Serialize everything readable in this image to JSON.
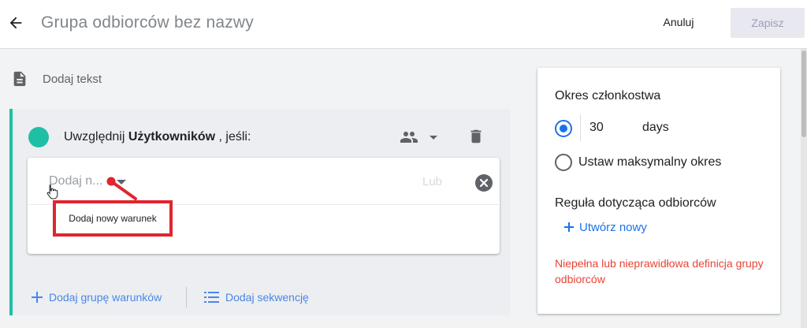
{
  "header": {
    "title": "Grupa odbiorców bez nazwy",
    "cancel_label": "Anuluj",
    "save_label": "Zapisz"
  },
  "add_text": {
    "label": "Dodaj tekst"
  },
  "condition_group": {
    "include_prefix": "Uwzględnij",
    "include_entity": "Użytkowników",
    "include_suffix": ", jeśli:",
    "condition": {
      "select_placeholder": "Dodaj n...",
      "or_label": "Lub",
      "tooltip": "Dodaj nowy warunek"
    },
    "add_group_label": "Dodaj grupę warunków",
    "add_sequence_label": "Dodaj sekwencję"
  },
  "side_panel": {
    "membership_heading": "Okres członkostwa",
    "days_value": "30",
    "days_unit": "days",
    "max_period_label": "Ustaw maksymalny okres",
    "selected_option": "days",
    "rule_heading": "Reguła dotycząca odbiorców",
    "create_label": "Utwórz nowy",
    "error_message": "Niepełna lub nieprawidłowa definicja grupy odbiorców"
  },
  "colors": {
    "accent_teal": "#1fbfa5",
    "link_blue": "#4a86e8",
    "error_red": "#ea4335",
    "annotation_red": "#e0262f"
  },
  "icons": [
    "back-arrow-icon",
    "document-icon",
    "group-icon",
    "dropdown-icon",
    "trash-icon",
    "close-icon",
    "plus-icon",
    "list-icon",
    "hand-cursor-icon"
  ]
}
